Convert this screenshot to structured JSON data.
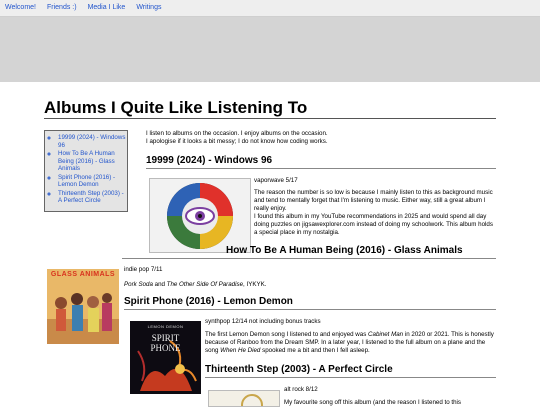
{
  "nav": {
    "items": [
      {
        "label": "Welcome!"
      },
      {
        "label": "Friends :)"
      },
      {
        "label": "Media I Like"
      },
      {
        "label": "Writings"
      }
    ]
  },
  "page": {
    "title": "Albums I Quite Like Listening To"
  },
  "toc": {
    "items": [
      {
        "label": "19999 (2024) - Windows 96"
      },
      {
        "label": "How To Be A Human Being (2016) - Glass Animals"
      },
      {
        "label": "Spirit Phone (2016) - Lemon Demon"
      },
      {
        "label": "Thirteenth Step (2003) - A Perfect Circle"
      }
    ]
  },
  "intro": {
    "line1": "I listen to albums on the occasion. I enjoy albums on the occasion.",
    "line2": "I apologise if it looks a bit messy; I do not know how coding works."
  },
  "albums": [
    {
      "heading": "19999 (2024) - Windows 96",
      "meta": "vaporwave 5/17",
      "body": "The reason the number is so low is because I mainly listen to this as background music and tend to mentally forget that I'm listening to music. Either way, still a great album I really enjoy.",
      "body2": "I found this album in my YouTube recommendations in 2025 and would spend all day doing puzzles on jigsawexplorer.com instead of doing my schoolwork. This album holds a special place in my nostalgia."
    },
    {
      "heading": "How To Be A Human Being (2016) - Glass Animals",
      "meta": "indie pop 7/11",
      "body_a": "Pork Soda",
      "body_b": " and ",
      "body_c": "The Other Side Of Paradise",
      "body_d": ", IYKYK.",
      "cover_text": "GLASS ANIMALS"
    },
    {
      "heading": "Spirit Phone (2016) - Lemon Demon",
      "meta": "synthpop 12/14 not including bonus tracks",
      "body_a": "The first Lemon Demon song I listened to and enjoyed was ",
      "body_b": "Cabinet Man",
      "body_c": " in 2020 or 2021. This is honestly because of Ranboo from the Dream SMP. In a later year, I listened to the full album on a plane and the song ",
      "body_d": "When He Died",
      "body_e": " spooked me a bit and then I fell asleep.",
      "cover_text_1": "LEMON DEMON",
      "cover_text_2": "SPIRIT",
      "cover_text_3": "PHONE"
    },
    {
      "heading": "Thirteenth Step (2003) - A Perfect Circle",
      "meta": "alt rock 8/12",
      "body": "My favourite song off this album (and the reason I listened to this"
    }
  ],
  "colors": {
    "link": "#2255cc",
    "nav_bg": "#eeeeee",
    "banner_bg": "#d4d4d4",
    "toc_bg": "#e4e4e4"
  }
}
